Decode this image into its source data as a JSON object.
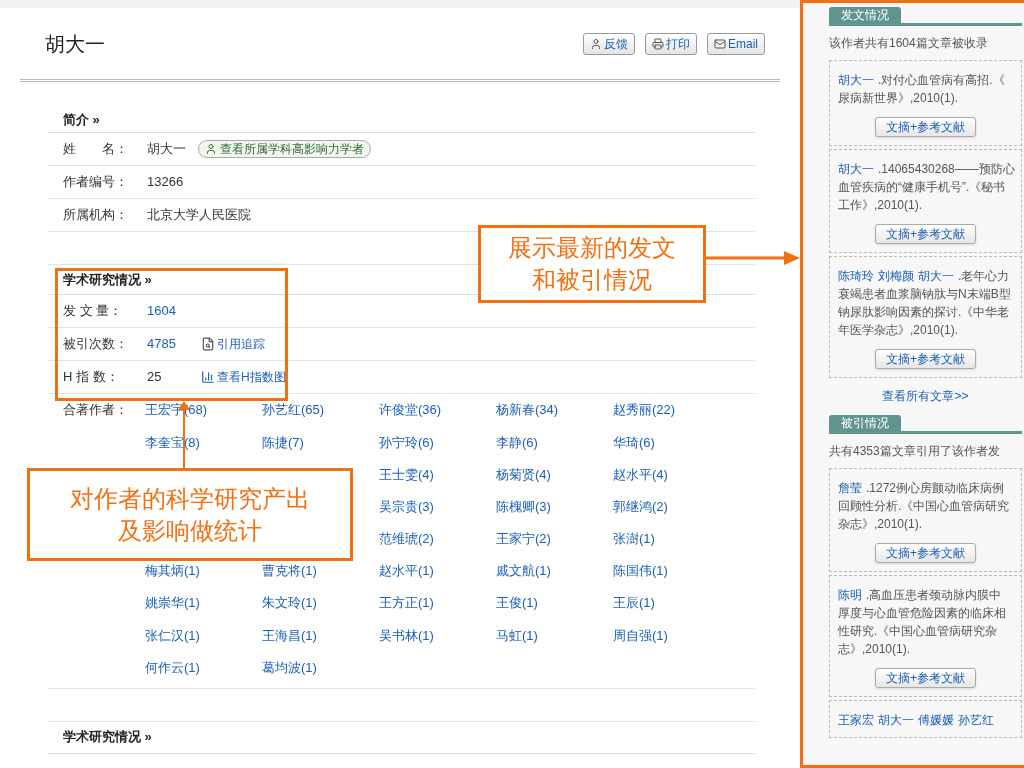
{
  "author_name": "胡大一",
  "actions": [
    {
      "kind": "feedback",
      "label": "反馈"
    },
    {
      "kind": "print",
      "label": "打印"
    },
    {
      "kind": "email",
      "label": "Email"
    }
  ],
  "profile": {
    "heading": "简介 »",
    "rows": [
      {
        "label": "姓　　名：",
        "value": "胡大一",
        "badge": "查看所属学科高影响力学者"
      },
      {
        "label": "作者编号：",
        "value": "13266"
      },
      {
        "label": "所属机构：",
        "value": "北京大学人民医院"
      }
    ]
  },
  "research": {
    "heading": "学术研究情况 »",
    "rows": [
      {
        "label": "发 文 量：",
        "value": "1604",
        "kind": "link"
      },
      {
        "label": "被引次数：",
        "value": "4785",
        "kind": "tracked_link",
        "action": "引用追踪"
      },
      {
        "label": "H 指 数：",
        "value": "25",
        "kind": "chart",
        "action": "查看H指数图"
      }
    ],
    "coauthors_label": "合著作者：",
    "coauthor_rows": [
      {
        "covered": false,
        "cells": [
          "王宏宇(68)",
          "孙艺红(65)",
          "许俊堂(36)",
          "杨新春(34)",
          "赵秀丽(22)"
        ]
      },
      {
        "covered": false,
        "cells": [
          "李奎宝(8)",
          "陈捷(7)",
          "孙宁玲(6)",
          "李静(6)",
          "华琦(6)"
        ]
      },
      {
        "covered": true,
        "cells": [
          "王士雯(4)",
          "杨菊贤(4)",
          "赵水平(4)"
        ]
      },
      {
        "covered": true,
        "cells": [
          "吴宗贵(3)",
          "陈槐卿(3)",
          "郭继鸿(2)"
        ]
      },
      {
        "covered": true,
        "cells": [
          "范维琥(2)",
          "王家宁(2)",
          "张澍(1)"
        ]
      },
      {
        "covered": false,
        "cells": [
          "梅其炳(1)",
          "曹克将(1)",
          "赵水平(1)",
          "戚文航(1)",
          "陈国伟(1)"
        ]
      },
      {
        "covered": false,
        "cells": [
          "姚崇华(1)",
          "朱文玲(1)",
          "王方正(1)",
          "王俊(1)",
          "王辰(1)"
        ]
      },
      {
        "covered": false,
        "cells": [
          "张仁汉(1)",
          "王海昌(1)",
          "吴书林(1)",
          "马虹(1)",
          "周自强(1)"
        ]
      },
      {
        "covered": false,
        "cells": [
          "何作云(1)",
          "葛均波(1)"
        ]
      }
    ]
  },
  "research_2": {
    "heading": "学术研究情况 »"
  },
  "callouts": [
    {
      "kind": "right",
      "lines": [
        "展示最新的发文",
        "和被引情况"
      ]
    },
    {
      "kind": "up",
      "lines": [
        "对作者的科学研究产出",
        "及影响做统计"
      ]
    }
  ],
  "side": {
    "publications": {
      "tab": "发文情况",
      "summary": "该作者共有1604篇文章被收录",
      "articles": [
        {
          "authors": [
            "胡大一"
          ],
          "lines": [
            ".对付心血管病有高招.《",
            "尿病新世界》,2010(1)."
          ],
          "button": "文摘+参考文献"
        },
        {
          "authors": [
            "胡大一"
          ],
          "lines": [
            ".14065430268——预防心",
            "血管疾病的“健康手机号”.《秘书",
            "工作》,2010(1)."
          ],
          "button": "文摘+参考文献"
        },
        {
          "authors": [
            "陈琦玲",
            "刘梅颜",
            "胡大一"
          ],
          "lines": [
            ".老年心力",
            "衰竭患者血浆脑钠肽与N末端B型",
            "钠尿肽影响因素的探讨.《中华老",
            "年医学杂志》,2010(1)."
          ],
          "button": "文摘+参考文献"
        }
      ],
      "more": "查看所有文章>>"
    },
    "citations": {
      "tab": "被引情况",
      "summary": "共有4353篇文章引用了该作者发",
      "articles": [
        {
          "authors": [
            "詹莹"
          ],
          "lines": [
            ".1272例心房颤动临床病例",
            "回顾性分析.《中国心血管病研究",
            "杂志》,2010(1)."
          ],
          "button": "文摘+参考文献"
        },
        {
          "authors": [
            "陈明"
          ],
          "lines": [
            ".高血压患者颈动脉内膜中",
            "厚度与心血管危险因素的临床相",
            "性研究.《中国心血管病研究杂",
            "志》,2010(1)."
          ],
          "button": "文摘+参考文献"
        },
        {
          "authors": [
            "王家宏",
            "胡大一",
            "傅媛媛",
            "孙艺红"
          ]
        }
      ]
    }
  }
}
